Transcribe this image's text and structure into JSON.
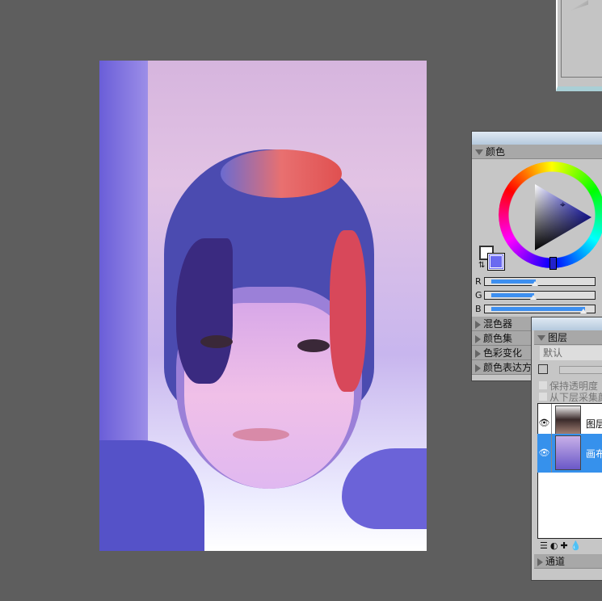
{
  "color_panel": {
    "title": "颜色",
    "sliders": [
      {
        "label": "R",
        "value": 0.45
      },
      {
        "label": "G",
        "value": 0.43
      },
      {
        "label": "B",
        "value": 0.95
      }
    ],
    "sections": [
      "混色器",
      "颜色集",
      "色彩变化",
      "颜色表达方"
    ],
    "foreground": "#ffffff",
    "background": "#6a6af0"
  },
  "layers_panel": {
    "title": "图层",
    "blend_mode": "默认",
    "options": [
      "保持透明度",
      "从下层采集颜"
    ],
    "layers": [
      {
        "name": "图层",
        "selected": false
      },
      {
        "name": "画布",
        "selected": true
      }
    ],
    "channels": "通道"
  }
}
